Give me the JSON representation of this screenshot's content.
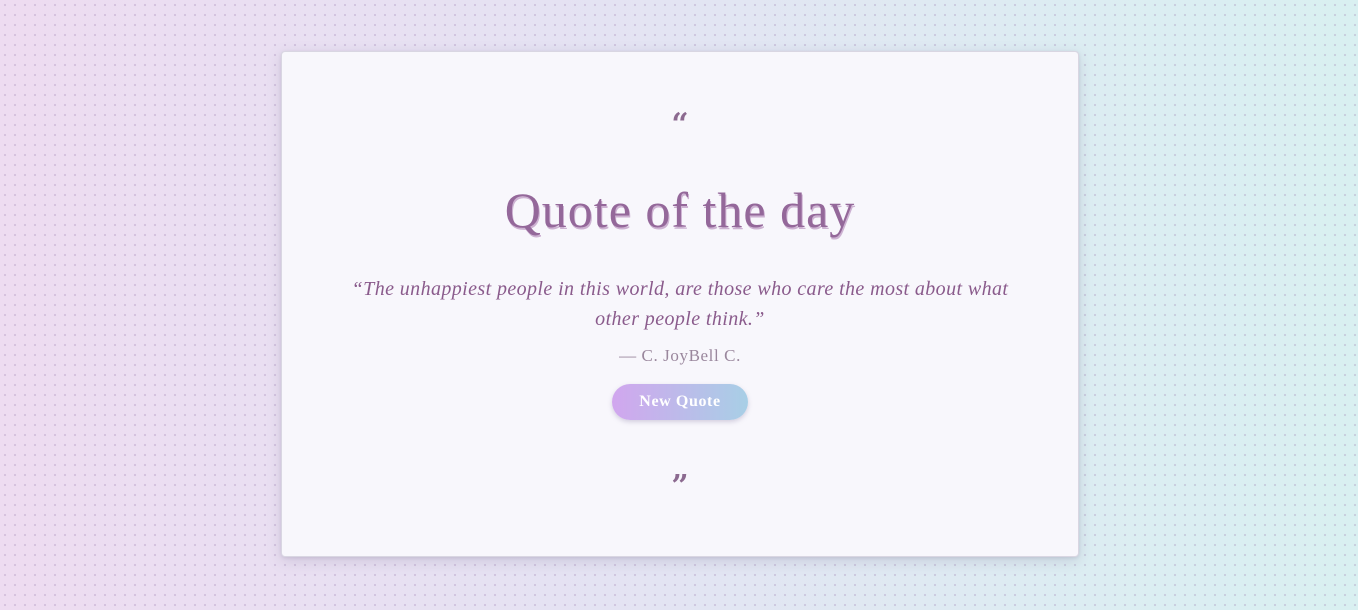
{
  "card": {
    "open_quote_icon": "“",
    "close_quote_icon": "”",
    "title": "Quote of the day",
    "quote": "“The unhappiest people in this world, are those who care the most about what other people think.”",
    "author": "— C. JoyBell C.",
    "new_quote_button_label": "New Quote"
  },
  "colors": {
    "accent": "#94689a",
    "quote_text": "#8a5b8c",
    "button_gradient_start": "#d1a6ee",
    "button_gradient_end": "#a8cfe6"
  },
  "icons": [
    "open-quote-icon",
    "close-quote-icon"
  ]
}
